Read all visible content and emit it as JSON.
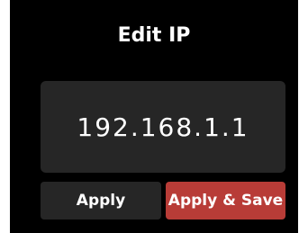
{
  "dialog": {
    "title": "Edit IP",
    "ip_value": "192.168.1.1",
    "apply_label": "Apply",
    "apply_save_label": "Apply & Save"
  },
  "colors": {
    "background": "#000000",
    "panel": "#262626",
    "accent": "#b83c37",
    "text": "#ffffff"
  }
}
